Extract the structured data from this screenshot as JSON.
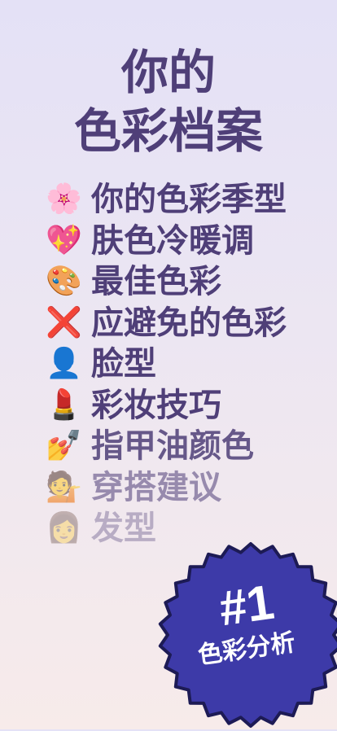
{
  "title": {
    "line1": "你的",
    "line2": "色彩档案"
  },
  "features": [
    {
      "icon": "cherry-blossom-icon",
      "emoji": "🌸",
      "label": "你的色彩季型"
    },
    {
      "icon": "sparkling-heart-icon",
      "emoji": "💖",
      "label": "肤色冷暖调"
    },
    {
      "icon": "artist-palette-icon",
      "emoji": "🎨",
      "label": "最佳色彩"
    },
    {
      "icon": "cross-mark-icon",
      "emoji": "❌",
      "label": "应避免的色彩"
    },
    {
      "icon": "bust-silhouette-icon",
      "emoji": "👤",
      "label": "脸型"
    },
    {
      "icon": "lipstick-icon",
      "emoji": "💄",
      "label": "彩妆技巧"
    },
    {
      "icon": "nail-polish-icon",
      "emoji": "💅",
      "label": "指甲油颜色"
    },
    {
      "icon": "woman-tipping-hand-icon",
      "emoji": "💁",
      "label": "穿搭建议"
    },
    {
      "icon": "woman-face-icon",
      "emoji": "👩",
      "label": "发型"
    }
  ],
  "badge": {
    "rank": "#1",
    "subtitle": "色彩分析",
    "color": "#3d3aa8",
    "border_color": "#1d1b55"
  },
  "colors": {
    "title": "#4f3f78",
    "background_top": "#e4e1f6",
    "background_bottom": "#f7ebea"
  }
}
